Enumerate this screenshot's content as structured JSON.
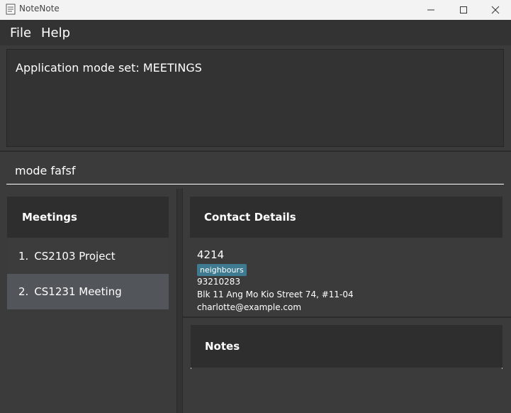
{
  "window": {
    "title": "NoteNote",
    "controls": [
      "minimize-icon",
      "maximize-icon",
      "close-icon"
    ]
  },
  "menu": {
    "items": [
      {
        "label": "File"
      },
      {
        "label": "Help"
      }
    ]
  },
  "result": {
    "text": "Application mode set: MEETINGS"
  },
  "command": {
    "value": "mode fafsf"
  },
  "meetings": {
    "header": "Meetings",
    "items": [
      {
        "index": "1.",
        "title": "CS2103 Project"
      },
      {
        "index": "2.",
        "title": "CS1231 Meeting"
      }
    ]
  },
  "contact": {
    "header": "Contact Details",
    "name": "4214",
    "tag": "neighbours",
    "phone": "93210283",
    "address": "Blk 11 Ang Mo Kio Street 74, #11-04",
    "email": "charlotte@example.com"
  },
  "notes": {
    "header": "Notes"
  },
  "colors": {
    "background": "#3b3b3b",
    "panel_header": "#2e2e2e",
    "selected_item": "#52565a",
    "tag": "#3e7b91",
    "titlebar": "#f3f3f3"
  }
}
